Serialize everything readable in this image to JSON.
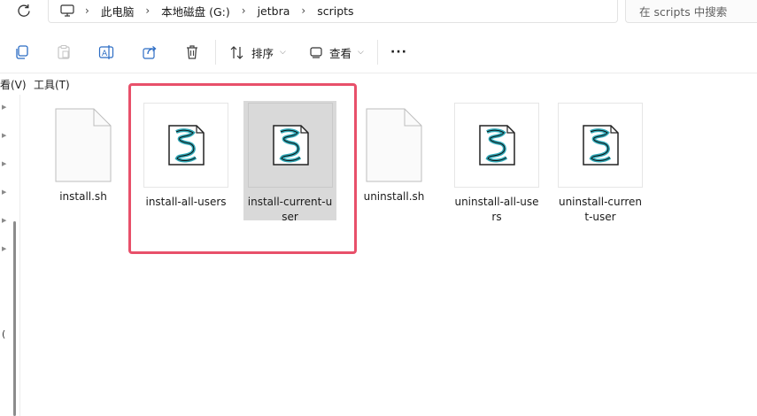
{
  "address_bar": {
    "breadcrumbs": [
      "此电脑",
      "本地磁盘 (G:)",
      "jetbra",
      "scripts"
    ],
    "search_placeholder": "在 scripts 中搜索"
  },
  "toolbar": {
    "sort_label": "排序",
    "view_label": "查看",
    "more_label": "···"
  },
  "menubar": {
    "view_partial": "看(V)",
    "tools": "工具(T)"
  },
  "files": [
    {
      "name": "install.sh",
      "icon": "generic-file-icon",
      "selected": false
    },
    {
      "name": "install-all-users",
      "icon": "script-file-icon",
      "selected": false
    },
    {
      "name": "install-current-user",
      "icon": "script-file-icon",
      "selected": true
    },
    {
      "name": "uninstall.sh",
      "icon": "generic-file-icon",
      "selected": false
    },
    {
      "name": "uninstall-all-users",
      "icon": "script-file-icon",
      "selected": false
    },
    {
      "name": "uninstall-current-user",
      "icon": "script-file-icon",
      "selected": false
    }
  ],
  "colors": {
    "highlight": "#e8506a",
    "selection": "#d9d9d9"
  }
}
